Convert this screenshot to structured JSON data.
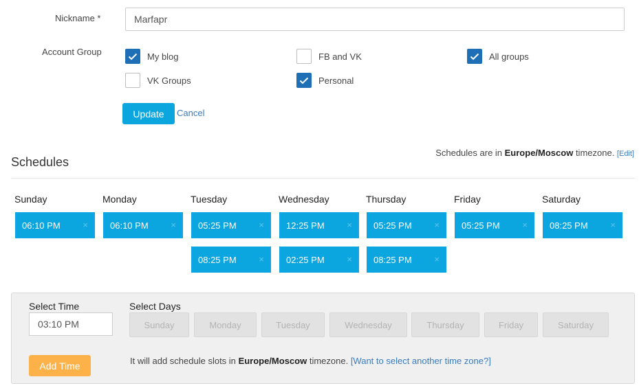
{
  "form": {
    "nickname_label": "Nickname *",
    "nickname_value": "Marfapr",
    "account_group_label": "Account Group",
    "groups": [
      {
        "label": "My blog",
        "checked": true
      },
      {
        "label": "FB and VK",
        "checked": false
      },
      {
        "label": "All groups",
        "checked": true
      },
      {
        "label": "VK Groups",
        "checked": false
      },
      {
        "label": "Personal",
        "checked": true
      }
    ],
    "update_label": "Update",
    "cancel_label": "Cancel"
  },
  "schedules": {
    "title": "Schedules",
    "tz_prefix": "Schedules are in ",
    "timezone": "Europe/Moscow",
    "tz_suffix": " timezone. ",
    "edit_label": "[Edit]",
    "remove_glyph": "×",
    "days": [
      {
        "name": "Sunday",
        "slots": [
          "06:10 PM"
        ]
      },
      {
        "name": "Monday",
        "slots": [
          "06:10 PM"
        ]
      },
      {
        "name": "Tuesday",
        "slots": [
          "05:25 PM",
          "08:25 PM"
        ]
      },
      {
        "name": "Wednesday",
        "slots": [
          "12:25 PM",
          "02:25 PM"
        ]
      },
      {
        "name": "Thursday",
        "slots": [
          "05:25 PM",
          "08:25 PM"
        ]
      },
      {
        "name": "Friday",
        "slots": [
          "05:25 PM"
        ]
      },
      {
        "name": "Saturday",
        "slots": [
          "08:25 PM"
        ]
      }
    ]
  },
  "add_panel": {
    "select_time_label": "Select Time",
    "time_value": "03:10 PM",
    "select_days_label": "Select Days",
    "day_buttons": [
      "Sunday",
      "Monday",
      "Tuesday",
      "Wednesday",
      "Thursday",
      "Friday",
      "Saturday"
    ],
    "add_time_label": "Add Time",
    "note_prefix": "It will add schedule slots in ",
    "note_timezone": "Europe/Moscow",
    "note_suffix": " timezone. ",
    "note_link": "[Want to select another time zone?]"
  },
  "colors": {
    "slot_bg": "#0ba5df",
    "update_bg": "#0ca6df",
    "add_time_bg": "#fcb248",
    "checkbox_checked": "#1e6fb5",
    "link": "#3a7bbf"
  }
}
